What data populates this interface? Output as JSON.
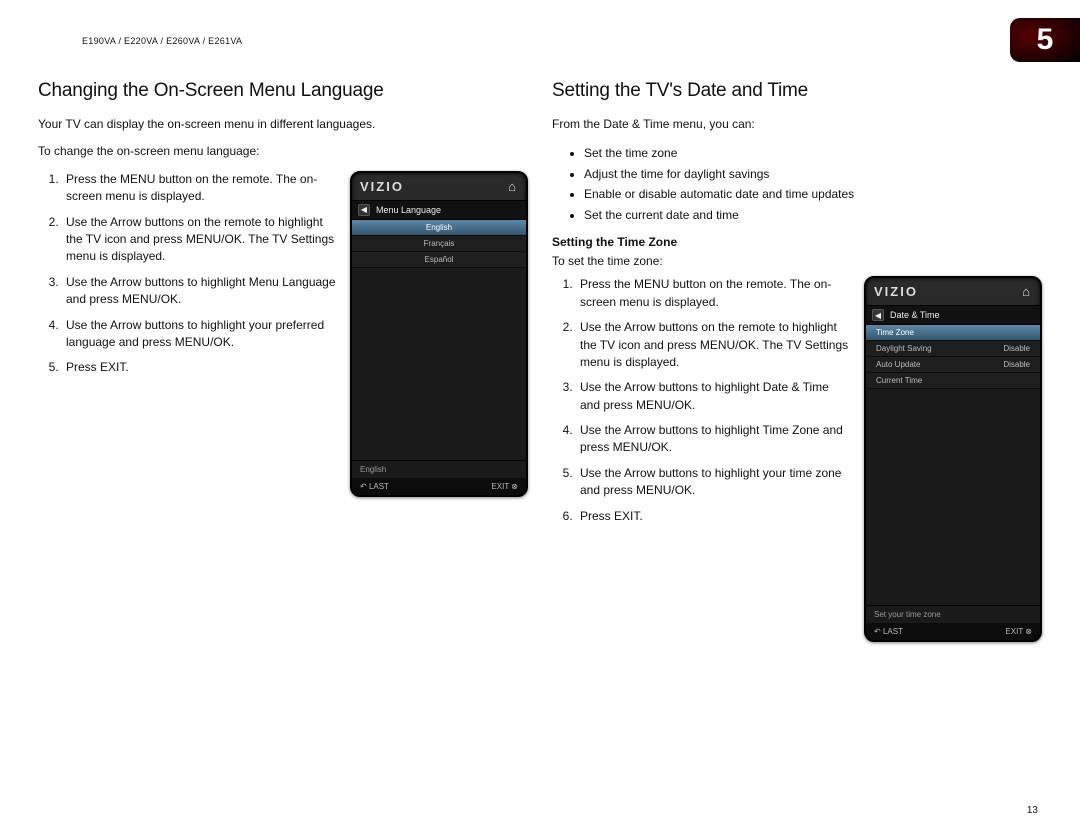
{
  "header": {
    "models": "E190VA / E220VA / E260VA / E261VA",
    "chapter": "5"
  },
  "left": {
    "title": "Changing the On-Screen Menu Language",
    "intro": "Your TV can display the on-screen menu in different languages.",
    "lead": "To change the on-screen menu language:",
    "steps": [
      "Press the MENU button on the remote. The on-screen menu is displayed.",
      "Use the Arrow buttons on the remote to highlight the TV icon and press MENU/OK. The TV Settings menu is displayed.",
      "Use the Arrow buttons to highlight Menu Language and press MENU/OK.",
      "Use the Arrow buttons to highlight your preferred language and press MENU/OK.",
      "Press EXIT."
    ],
    "osd": {
      "brand": "VIZIO",
      "title": "Menu Language",
      "items": [
        "English",
        "Français",
        "Español"
      ],
      "footer_info": "English",
      "last": "LAST",
      "exit": "EXIT"
    }
  },
  "right": {
    "title": "Setting the TV's Date and Time",
    "intro": "From the Date & Time menu, you can:",
    "bullets": [
      "Set the time zone",
      "Adjust the time for daylight savings",
      "Enable or disable automatic date and time updates",
      "Set the current date and time"
    ],
    "sub_head": "Setting the Time Zone",
    "sub_lead": "To set the time zone:",
    "steps": [
      "Press the MENU button on the remote. The on-screen menu is displayed.",
      "Use the Arrow buttons on the remote to highlight the TV icon and press MENU/OK. The TV Settings menu is displayed.",
      "Use the Arrow buttons to highlight Date & Time and press MENU/OK.",
      "Use the Arrow buttons to highlight Time Zone and press MENU/OK.",
      "Use the Arrow buttons to highlight your time zone and press MENU/OK.",
      "Press EXIT."
    ],
    "osd": {
      "brand": "VIZIO",
      "title": "Date & Time",
      "rows": [
        {
          "label": "Time Zone",
          "value": "",
          "hl": true
        },
        {
          "label": "Daylight Saving",
          "value": "Disable",
          "hl": false
        },
        {
          "label": "Auto Update",
          "value": "Disable",
          "hl": false
        },
        {
          "label": "Current Time",
          "value": "",
          "hl": false
        }
      ],
      "footer_info": "Set your time zone",
      "last": "LAST",
      "exit": "EXIT"
    }
  },
  "page_number": "13"
}
